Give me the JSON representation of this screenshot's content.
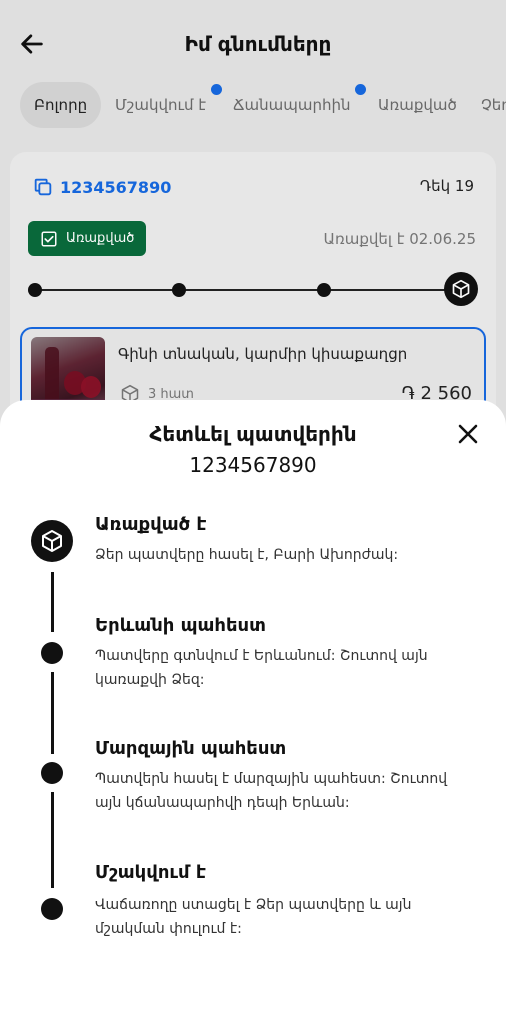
{
  "header": {
    "title": "Իմ գնումները"
  },
  "tabs": [
    {
      "label": "Բոլորը",
      "active": true,
      "dot": false
    },
    {
      "label": "Մշակվում է",
      "active": false,
      "dot": true
    },
    {
      "label": "Ճանապարհին",
      "active": false,
      "dot": true
    },
    {
      "label": "Առաքված",
      "active": false,
      "dot": false
    },
    {
      "label": "Չեղ",
      "active": false,
      "dot": false
    }
  ],
  "order": {
    "id": "1234567890",
    "date": "Դեկ 19",
    "status_label": "Առաքված",
    "delivered_text": "Առաքվել է 02.06.25",
    "progress_steps": 4,
    "progress_completed": 4,
    "product": {
      "name": "Գինի տնական, կարմիր կիսաքաղցր",
      "quantity": "3 հատ",
      "price": "֏ 2 560"
    }
  },
  "tracking_sheet": {
    "title": "Հետևել պատվերին",
    "order_id": "1234567890",
    "steps": [
      {
        "title": "Առաքված է",
        "description": "Ձեր պատվերը հասել է, Բարի Ախորժակ:",
        "current": true
      },
      {
        "title": "Երևանի պահեստ",
        "description": "Պատվերը գտնվում է Երևանում: Շուտով այն կառաքվի Ձեզ:",
        "current": false
      },
      {
        "title": "Մարզային պահեստ",
        "description": "Պատվերն հասել է մարզային պահեստ: Շուտով այն կճանապարհվի դեպի Երևան:",
        "current": false
      },
      {
        "title": "Մշակվում է",
        "description": "Վաճառողը ստացել է Ձեր պատվերը և այն մշակման փուլում է:",
        "current": false
      }
    ]
  },
  "colors": {
    "accent": "#1769e0",
    "status_green": "#0a6b3c",
    "dark": "#111111"
  }
}
